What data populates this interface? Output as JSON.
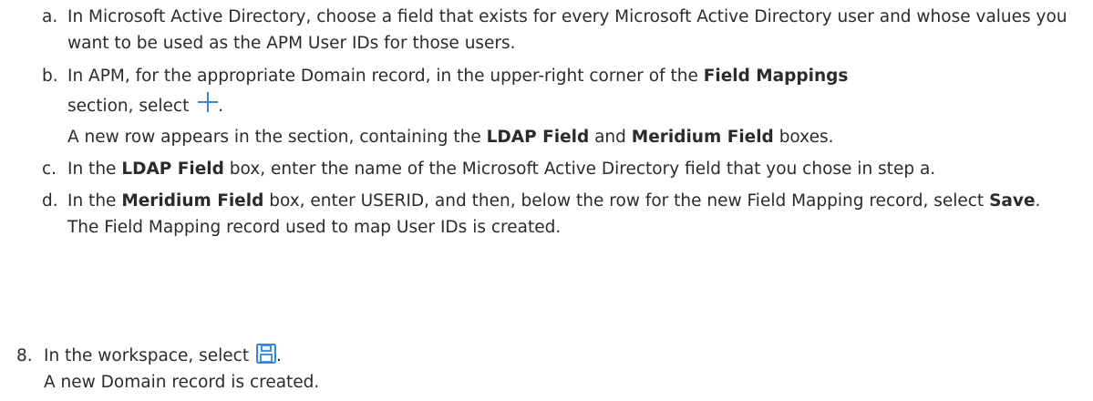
{
  "substeps": [
    {
      "marker": "a.",
      "parts": [
        "In Microsoft Active Directory, choose a field that exists for every Microsoft Active Directory user and whose values you want to be used as the APM User IDs for those users."
      ]
    },
    {
      "marker": "b.",
      "t1": "In APM, for the appropriate Domain record, in the upper-right corner of the ",
      "b1": "Field Mappings",
      "t2": " section, select ",
      "t3": ".",
      "icon": "plus-icon",
      "result_t1": "A new row appears in the section, containing the ",
      "result_b1": "LDAP Field",
      "result_t2": " and ",
      "result_b2": "Meridium Field",
      "result_t3": " boxes."
    },
    {
      "marker": "c.",
      "t1": "In the ",
      "b1": "LDAP Field",
      "t2": " box, enter the name of the Microsoft Active Directory field that you chose in step a."
    },
    {
      "marker": "d.",
      "t1": "In the ",
      "b1": "Meridium Field",
      "t2": " box, enter USERID, and then, below the row for the new Field Mapping record, select ",
      "b2": "Save",
      "t3": ".",
      "result": "The Field Mapping record used to map User IDs is created."
    }
  ],
  "step8": {
    "marker": "8.",
    "t1": "In the workspace, select ",
    "t2": ".",
    "icon": "save-icon",
    "result": "A new Domain record is created."
  },
  "colors": {
    "text": "#2b2b2b",
    "icon_accent": "#3a86d6"
  }
}
